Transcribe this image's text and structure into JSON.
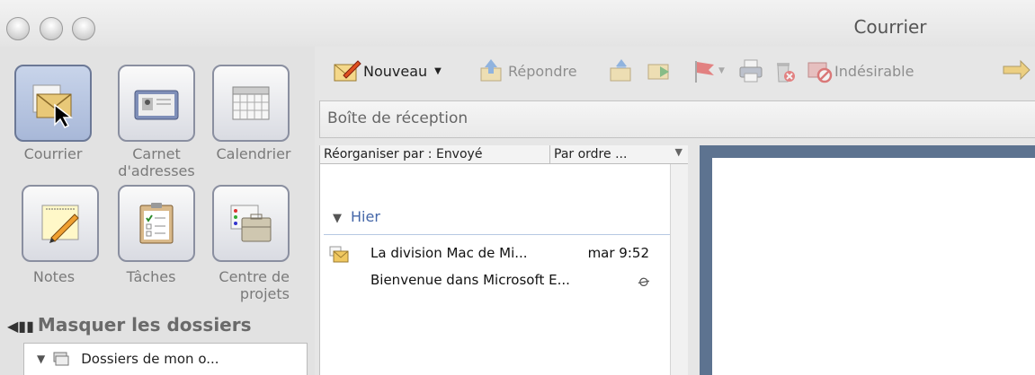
{
  "window": {
    "title": "Courrier"
  },
  "sidebar": {
    "apps": [
      {
        "label": "Courrier"
      },
      {
        "label": "Carnet\nd'adresses"
      },
      {
        "label": "Calendrier"
      },
      {
        "label": "Notes"
      },
      {
        "label": "Tâches"
      },
      {
        "label": "Centre de\nprojets"
      }
    ],
    "hide_folders_label": "Masquer les dossiers",
    "folder_root_label": "Dossiers de mon o..."
  },
  "toolbar": {
    "new_label": "Nouveau",
    "reply_label": "Répondre",
    "junk_label": "Indésirable"
  },
  "mailbox": {
    "title": "Boîte de réception"
  },
  "list": {
    "sort_by": "Réorganiser par : Envoyé",
    "sort_order": "Par ordre ...",
    "group_label": "Hier",
    "messages": [
      {
        "from": "La division Mac de Mi...",
        "time": "mar 9:52",
        "subject": "Bienvenue dans Microsoft E..."
      }
    ]
  },
  "colors": {
    "preview_border": "#5d7390",
    "group_text": "#4466a8"
  }
}
